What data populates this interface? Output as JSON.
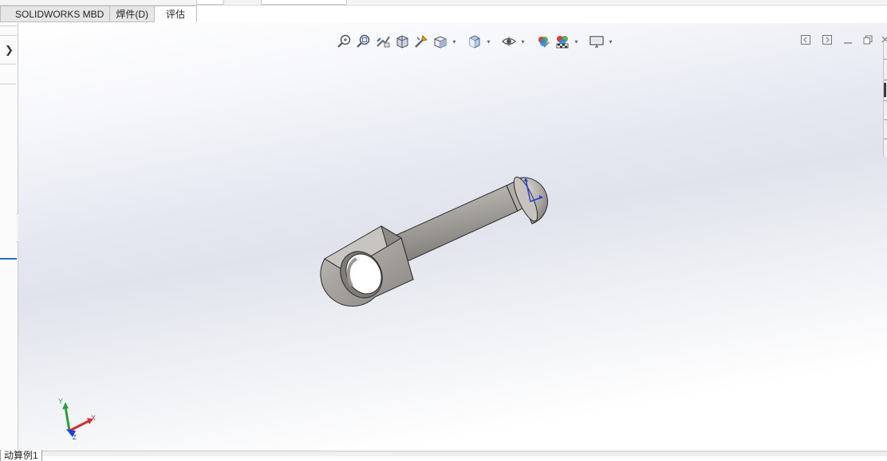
{
  "tabs": [
    {
      "label": "SOLIDWORKS MBD",
      "active": false
    },
    {
      "label": "焊件(D)",
      "active": false
    },
    {
      "label": "评估",
      "active": true
    }
  ],
  "heads_up_toolbar": [
    {
      "name": "zoom-to-fit-icon"
    },
    {
      "name": "zoom-to-area-icon"
    },
    {
      "name": "previous-view-icon"
    },
    {
      "name": "section-view-icon"
    },
    {
      "name": "dynamic-annotation-views-icon"
    },
    {
      "name": "view-orientation-icon",
      "dropdown": true
    },
    {
      "name": "display-style-icon",
      "dropdown": true
    },
    {
      "name": "hide-show-items-icon",
      "dropdown": true
    },
    {
      "name": "edit-appearance-icon"
    },
    {
      "name": "apply-scene-icon",
      "dropdown": true
    },
    {
      "name": "view-settings-icon",
      "dropdown": true
    }
  ],
  "triad": {
    "x_label": "X",
    "y_label": "Y",
    "z_label": "Z"
  },
  "bottom_tab": {
    "label": "动算例1"
  },
  "colors": {
    "part": "#a8a4a0",
    "triad_x": "#d32f2f",
    "triad_y": "#2e9e3a",
    "triad_z": "#1f3fd6"
  }
}
